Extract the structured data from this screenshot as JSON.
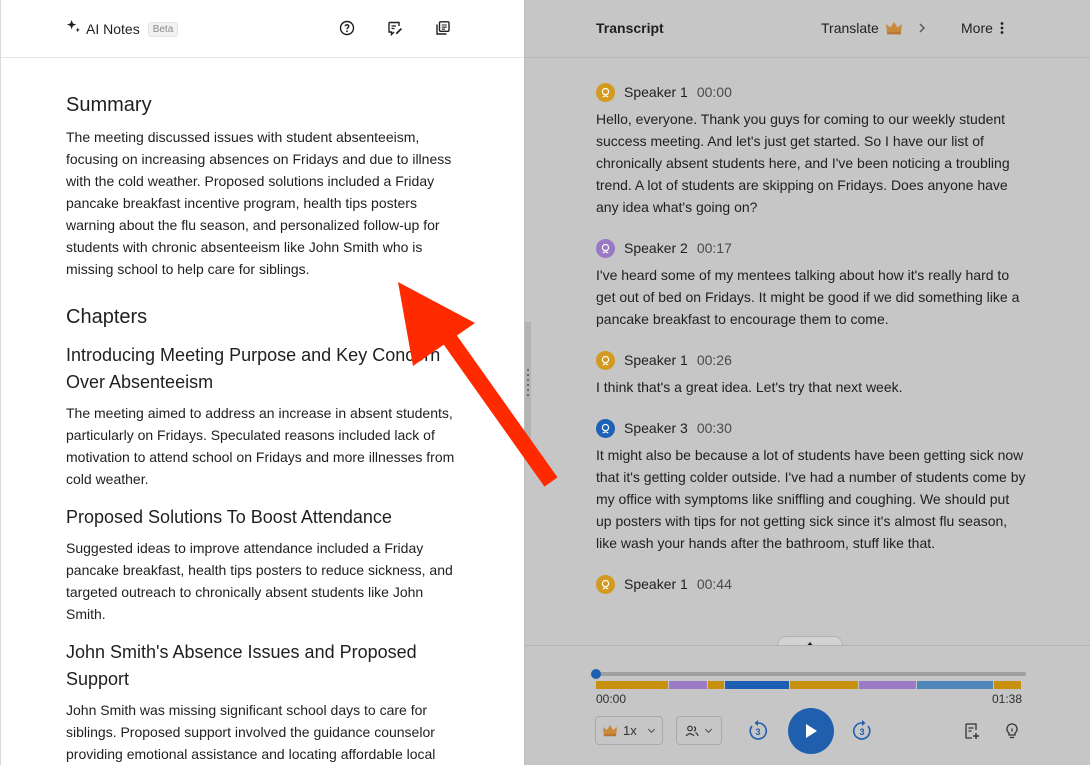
{
  "left": {
    "brand_title": "AI Notes",
    "badge": "Beta",
    "icons": [
      "help-icon",
      "chat-edit-icon",
      "copy-icon"
    ]
  },
  "summary": {
    "title": "Summary",
    "text": "The meeting discussed issues with student absenteeism, focusing on increasing absences on Fridays and due to illness with the cold weather. Proposed solutions included a Friday pancake breakfast incentive program, health tips posters warning about the flu season, and personalized follow-up for students with chronic absenteeism like John Smith who is missing school to help care for siblings."
  },
  "chapters": {
    "title": "Chapters",
    "items": [
      {
        "title": "Introducing Meeting Purpose and Key Concern Over Absenteeism",
        "text": "The meeting aimed to address an increase in absent students, particularly on Fridays. Speculated reasons included lack of motivation to attend school on Fridays and more illnesses from cold weather."
      },
      {
        "title": "Proposed Solutions To Boost Attendance",
        "text": "Suggested ideas to improve attendance included a Friday pancake breakfast, health tips posters to reduce sickness, and targeted outreach to chronically absent students like John Smith."
      },
      {
        "title": "John Smith's Absence Issues and Proposed Support",
        "text": "John Smith was missing significant school days to care for siblings. Proposed support involved the guidance counselor providing emotional assistance and locating affordable local"
      }
    ]
  },
  "transcript": {
    "title": "Transcript",
    "translate_label": "Translate",
    "more_label": "More",
    "entries": [
      {
        "speaker": "Speaker 1",
        "time": "00:00",
        "text": "Hello, everyone. Thank you guys for coming to our weekly student success meeting. And let's just get started. So I have our list of chronically absent students here, and I've been noticing a troubling trend. A lot of students are skipping on Fridays. Does anyone have any idea what's going on?"
      },
      {
        "speaker": "Speaker 2",
        "time": "00:17",
        "text": "I've heard some of my mentees talking about how it's really hard to get out of bed on Fridays. It might be good if we did something like a pancake breakfast to encourage them to come."
      },
      {
        "speaker": "Speaker 1",
        "time": "00:26",
        "text": "I think that's a great idea. Let's try that next week."
      },
      {
        "speaker": "Speaker 3",
        "time": "00:30",
        "text": "It might also be because a lot of students have been getting sick now that it's getting colder outside. I've had a number of students come by my office with symptoms like sniffling and coughing. We should put up posters with tips for not getting sick since it's almost flu season, like wash your hands after the bathroom, stuff like that."
      },
      {
        "speaker": "Speaker 1",
        "time": "00:44",
        "text": ""
      }
    ]
  },
  "player": {
    "time_start": "00:00",
    "time_end": "01:38",
    "speed": "1x",
    "progress": 0.0,
    "segments": [
      {
        "speaker": "Speaker 1",
        "fraction": 0.17,
        "color": "#c8900f"
      },
      {
        "speaker": "Speaker 2",
        "fraction": 0.09,
        "color": "#9b7bc6"
      },
      {
        "speaker": "Speaker 1",
        "fraction": 0.04,
        "color": "#c8900f"
      },
      {
        "speaker": "Speaker 3",
        "fraction": 0.15,
        "color": "#1d5fb3"
      },
      {
        "speaker": "Speaker 1",
        "fraction": 0.16,
        "color": "#c8900f"
      },
      {
        "speaker": "Speaker 2",
        "fraction": 0.135,
        "color": "#9b7bc6"
      },
      {
        "speaker": "Speaker 3",
        "fraction": 0.18,
        "color": "#4f86bb"
      },
      {
        "speaker": "Speaker 1",
        "fraction": 0.065,
        "color": "#c8900f"
      }
    ]
  },
  "colors": {
    "speaker1": "#d49a1f",
    "speaker2": "#9a78c4",
    "speaker3": "#1e62b8",
    "accent": "#1f5fae",
    "arrow": "#ff2a00"
  }
}
